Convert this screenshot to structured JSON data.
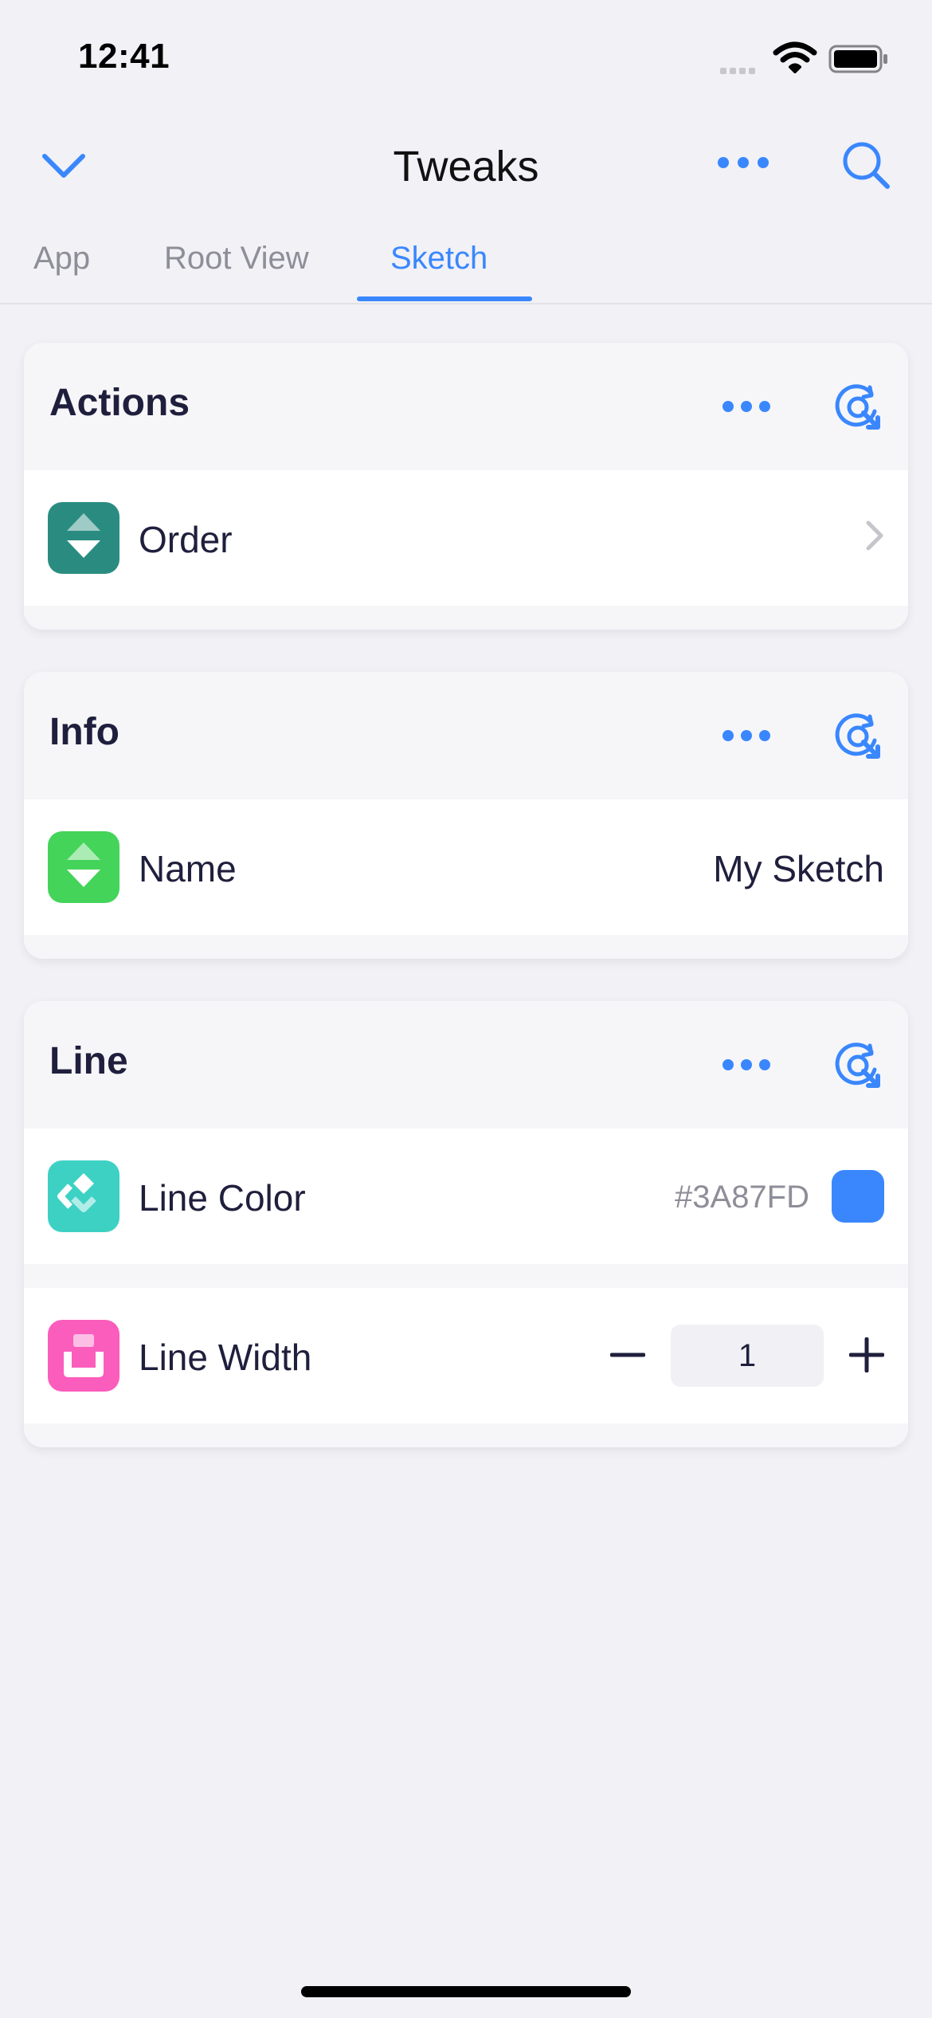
{
  "status": {
    "time": "12:41"
  },
  "nav": {
    "title": "Tweaks"
  },
  "tabs": [
    {
      "label": "App",
      "active": false
    },
    {
      "label": "Root View",
      "active": false
    },
    {
      "label": "Sketch",
      "active": true
    }
  ],
  "sections": [
    {
      "title": "Actions",
      "rows": [
        {
          "label": "Order",
          "icon": "order-icon",
          "icon_color": "#2a8c80",
          "accessory": "chevron"
        }
      ]
    },
    {
      "title": "Info",
      "rows": [
        {
          "label": "Name",
          "icon": "name-icon",
          "icon_color": "#44d45a",
          "value": "My Sketch"
        }
      ]
    },
    {
      "title": "Line",
      "rows": [
        {
          "label": "Line Color",
          "icon": "color-icon",
          "icon_color": "#3dd1c4",
          "value": "#3A87FD",
          "swatch": "#3A87FD"
        },
        {
          "label": "Line Width",
          "icon": "width-icon",
          "icon_color": "#fb5dbd",
          "value": "1"
        }
      ]
    }
  ],
  "colors": {
    "accent": "#3a87fd",
    "background": "#f1f1f6",
    "text": "#1f1f3d"
  }
}
